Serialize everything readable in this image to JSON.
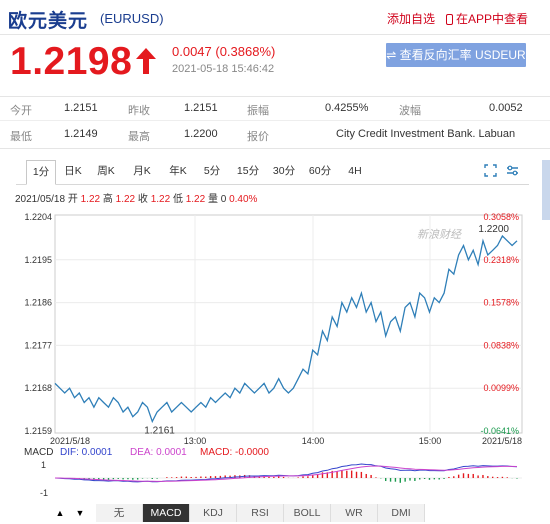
{
  "header": {
    "title": "欧元美元",
    "code": "(EURUSD)",
    "add_watch": "添加自选",
    "app_view": "在APP中查看"
  },
  "quote": {
    "price": "1.2198",
    "change": "0.0047 (0.3868%)",
    "datetime": "2021-05-18 15:46:42",
    "reverse_button": "⇌ 查看反向汇率 USDEUR"
  },
  "info": {
    "open_label": "今开",
    "open_value": "1.2151",
    "prev_label": "昨收",
    "prev_value": "1.2151",
    "amp_label": "振幅",
    "amp_value": "0.4255%",
    "wave_label": "波幅",
    "wave_value": "0.0052",
    "low_label": "最低",
    "low_value": "1.2149",
    "high_label": "最高",
    "high_value": "1.2200",
    "quote_label": "报价",
    "quote_value": "City Credit Investment Bank. Labuan"
  },
  "tabs": [
    "1分",
    "日K",
    "周K",
    "月K",
    "年K",
    "5分",
    "15分",
    "30分",
    "60分",
    "4H"
  ],
  "active_tab": "1分",
  "stat_line": {
    "date": "2021/05/18",
    "open_label": "开",
    "open": "1.22",
    "high_label": "高",
    "high": "1.22",
    "close_label": "收",
    "close": "1.22",
    "low_label": "低",
    "low": "1.22",
    "vol_label": "量",
    "vol": "0",
    "pct": "0.40%"
  },
  "watermark": "新浪财经",
  "chart_data": {
    "type": "line",
    "ylim": [
      1.2159,
      1.2204
    ],
    "y_ticks": [
      "1.2204",
      "1.2195",
      "1.2186",
      "1.2177",
      "1.2168",
      "1.2159"
    ],
    "pct_ticks": [
      "0.3058%",
      "0.2318%",
      "0.1578%",
      "0.0838%",
      "0.0099%",
      "-0.0641%"
    ],
    "x_ticks": [
      "2021/5/18",
      "13:00",
      "14:00",
      "15:00",
      "2021/5/18"
    ],
    "high_label": "1.2200",
    "low_label": "1.2161",
    "series": [
      {
        "values": [
          1.2169,
          1.2168,
          1.2167,
          1.2168,
          1.2166,
          1.2167,
          1.2165,
          1.2166,
          1.2164,
          1.2166,
          1.2165,
          1.2164,
          1.2166,
          1.2165,
          1.2163,
          1.2164,
          1.2162,
          1.2163,
          1.2165,
          1.2164,
          1.2161,
          1.2163,
          1.2164,
          1.2165,
          1.2163,
          1.2164,
          1.2165,
          1.2164,
          1.2163,
          1.2164,
          1.2165,
          1.2164,
          1.2166,
          1.2165,
          1.2166,
          1.2167,
          1.2166,
          1.2168,
          1.2167,
          1.2169,
          1.2168,
          1.2167,
          1.2168,
          1.2169,
          1.2167,
          1.2168,
          1.217,
          1.2168,
          1.2167,
          1.2168,
          1.217,
          1.2172,
          1.2171,
          1.2176,
          1.2175,
          1.218,
          1.2178,
          1.2183,
          1.2181,
          1.2186,
          1.2184,
          1.2187,
          1.2185,
          1.2188,
          1.2184,
          1.2186,
          1.2182,
          1.2184,
          1.2179,
          1.2182,
          1.2183,
          1.218,
          1.2185,
          1.2186,
          1.2183,
          1.2188,
          1.2187,
          1.2184,
          1.2187,
          1.2186,
          1.2188,
          1.2193,
          1.2192,
          1.2196,
          1.2198,
          1.2195,
          1.2197,
          1.2194,
          1.2199,
          1.2196,
          1.2197,
          1.2198,
          1.22,
          1.2199,
          1.2198,
          1.2199
        ]
      }
    ]
  },
  "macd": {
    "label": "MACD",
    "dif": "DIF: 0.0001",
    "dea": "DEA: 0.0001",
    "macd": "MACD: -0.0000",
    "y_ticks": [
      "1",
      "-1"
    ]
  },
  "indicator_tabs": [
    "无",
    "MACD",
    "KDJ",
    "RSI",
    "BOLL",
    "WR",
    "DMI"
  ],
  "active_indicator": "MACD",
  "colors": {
    "up": "#e4191e",
    "down": "#1a9a4e",
    "line": "#2f7fb8",
    "dif": "#3344cc",
    "dea": "#cc44cc",
    "brand": "#1a3d8f"
  }
}
